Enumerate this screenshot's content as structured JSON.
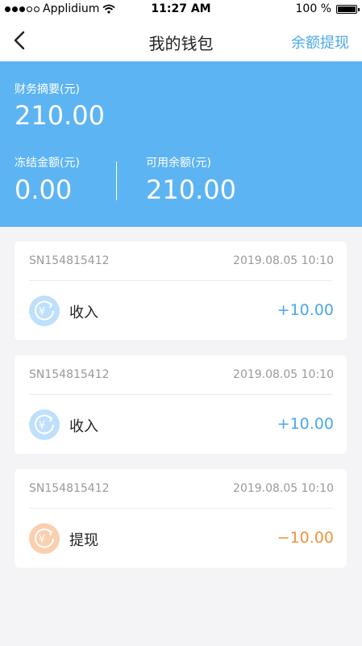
{
  "status_bar": {
    "carrier": "Applidium",
    "time": "11:27 AM",
    "battery": "100 %"
  },
  "nav": {
    "title": "我的钱包",
    "action": "余额提现",
    "back_icon": "chevron-left-icon"
  },
  "summary": {
    "total_label": "财务摘要(元)",
    "total_value": "210.00",
    "frozen_label": "冻结金额(元)",
    "frozen_value": "0.00",
    "available_label": "可用余额(元)",
    "available_value": "210.00"
  },
  "colors": {
    "accent": "#4ba8ea",
    "summary_bg": "#5db4f2",
    "income_icon_bg": "#bfe0fb",
    "withdraw_icon_bg": "#f9cfae",
    "withdraw_amount": "#f0933c"
  },
  "transactions": [
    {
      "sn": "SN154815412",
      "time": "2019.08.05 10:10",
      "type": "收入",
      "amount": "+10.00",
      "icon": "yuan-refund-icon"
    },
    {
      "sn": "SN154815412",
      "time": "2019.08.05 10:10",
      "type": "收入",
      "amount": "+10.00",
      "icon": "yuan-refund-icon"
    },
    {
      "sn": "SN154815412",
      "time": "2019.08.05 10:10",
      "type": "提现",
      "amount": "−10.00",
      "icon": "yuan-refund-icon"
    }
  ]
}
